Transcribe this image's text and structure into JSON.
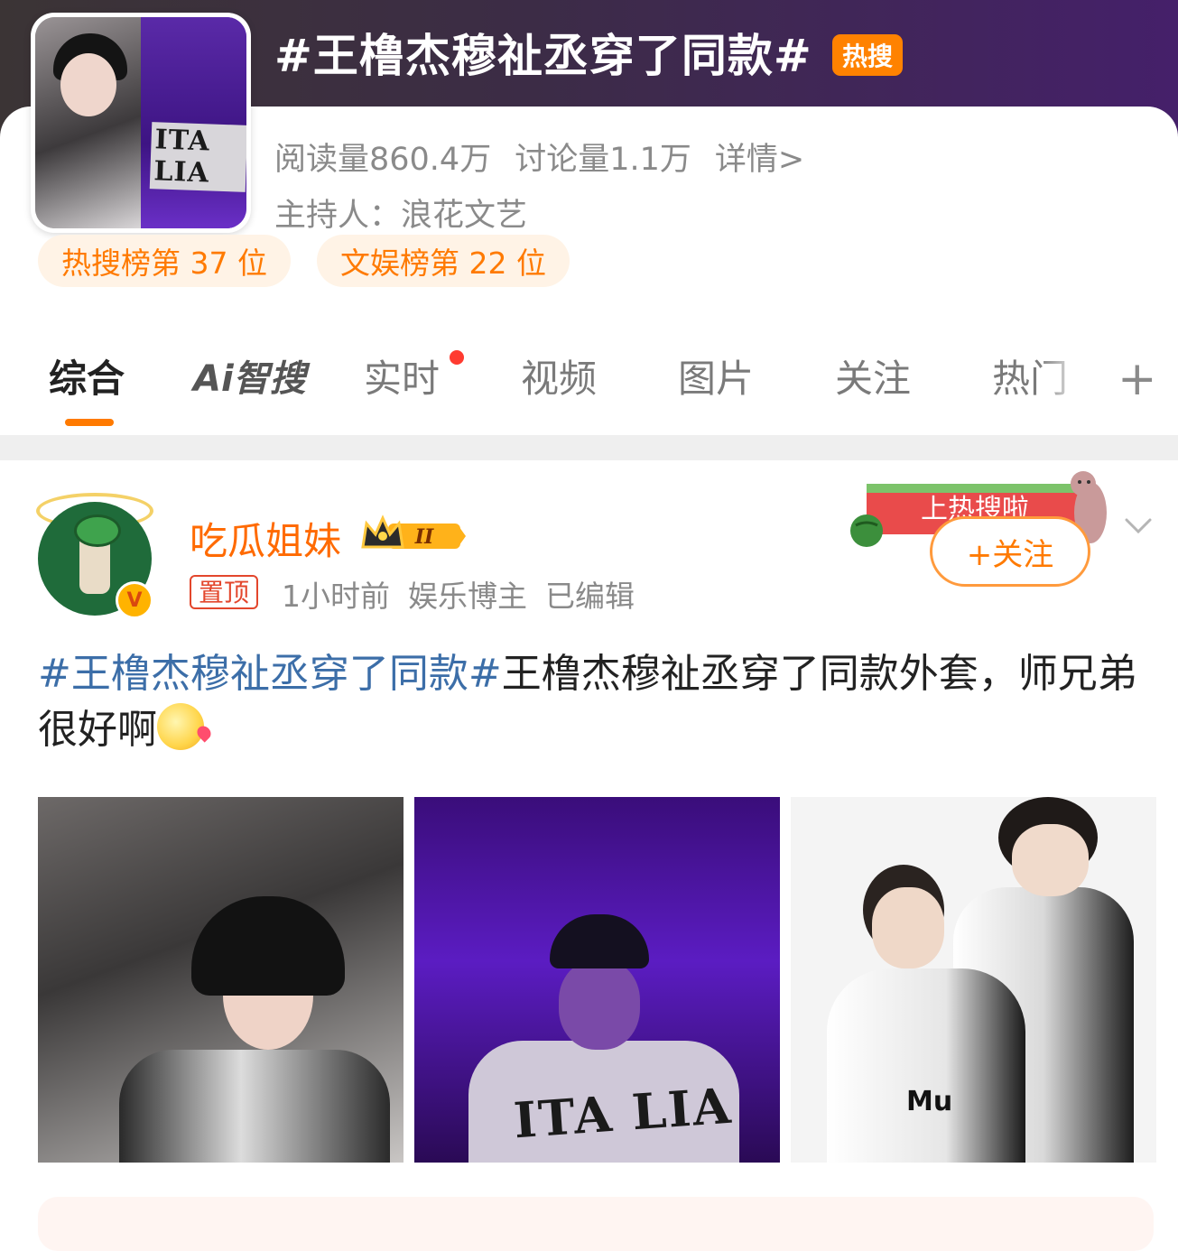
{
  "topic": {
    "title": "#王橹杰穆祉丞穿了同款#",
    "hot_badge": "热搜",
    "reads": "阅读量860.4万",
    "discussions": "讨论量1.1万",
    "details": "详情>",
    "host": "主持人：浪花文艺",
    "ranks": [
      "热搜榜第 37 位",
      "文娱榜第 22 位"
    ],
    "cover_text": "ITA LIA"
  },
  "tabs": {
    "items": [
      "综合",
      "智搜",
      "实时",
      "视频",
      "图片",
      "关注",
      "热门"
    ],
    "ai_prefix": "Ai",
    "active": "综合",
    "more": "+"
  },
  "post": {
    "username": "吃瓜姐妹",
    "level_badge": "II",
    "pinned": "置顶",
    "time": "1小时前",
    "role": "娱乐博主",
    "edited": "已编辑",
    "avatar_badge": "V",
    "sticker_text": "上热搜啦",
    "follow_label": "+关注",
    "topic_link": "#王橹杰穆祉丞穿了同款#",
    "text": "王橹杰穆祉丞穿了同款外套，师兄弟很好啊",
    "photo2_text": "ITA LIA",
    "photo3_text": "Mu"
  },
  "colors": {
    "accent": "#ff7a00",
    "hot_badge": "#ff8200",
    "topic_link": "#3c6ea8",
    "pin_red": "#e3462c"
  },
  "icons": [
    "chevron-down-icon",
    "plus-icon",
    "crown-icon",
    "verified-v-icon",
    "emoji-blush-icon",
    "watermelon-sticker-icon"
  ]
}
